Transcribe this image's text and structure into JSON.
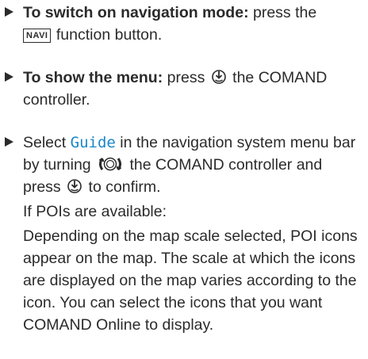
{
  "steps": [
    {
      "bold": "To switch on navigation mode:",
      "text_a": " press the",
      "key": "NAVI",
      "text_b": " function button."
    },
    {
      "bold": "To show the menu:",
      "text_a": " press",
      "text_b": " the COMAND controller."
    },
    {
      "text_a": "Select ",
      "menu_item": "Guide",
      "text_b": " in the navigation system menu bar by turning",
      "text_c": " the COMAND controller and press",
      "text_d": " to confirm.",
      "condition": "If POIs are available:",
      "description": "Depending on the map scale selected, POI icons appear on the map. The scale at which the icons are displayed on the map varies according to the icon. You can select the icons that you want COMAND Online to display."
    }
  ],
  "icons": {
    "bullet": "triangle-bullet-icon",
    "press": "controller-press-icon",
    "turn": "controller-turn-icon"
  },
  "colors": {
    "text": "#2b2b2b",
    "menu_item": "#1a87c9"
  }
}
